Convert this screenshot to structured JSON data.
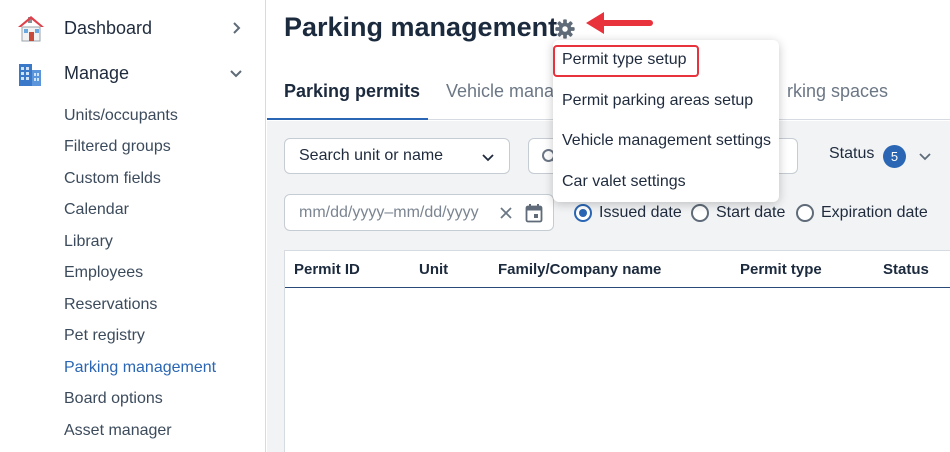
{
  "sidebar": {
    "dashboard_label": "Dashboard",
    "manage_label": "Manage",
    "items": [
      {
        "label": "Units/occupants"
      },
      {
        "label": "Filtered groups"
      },
      {
        "label": "Custom fields"
      },
      {
        "label": "Calendar"
      },
      {
        "label": "Library"
      },
      {
        "label": "Employees"
      },
      {
        "label": "Reservations"
      },
      {
        "label": "Pet registry"
      },
      {
        "label": "Parking management"
      },
      {
        "label": "Board options"
      },
      {
        "label": "Asset manager"
      }
    ]
  },
  "header": {
    "title": "Parking management"
  },
  "tabs": [
    {
      "label": "Parking permits"
    },
    {
      "label": "Vehicle mana"
    },
    {
      "label": "rking spaces"
    }
  ],
  "filters": {
    "search_by_label": "Search unit or name",
    "status_label": "Status",
    "status_count": "5",
    "date_placeholder": "mm/dd/yyyy–mm/dd/yyyy",
    "date_options": [
      {
        "label": "Issued date",
        "checked": true
      },
      {
        "label": "Start date",
        "checked": false
      },
      {
        "label": "Expiration date",
        "checked": false
      }
    ]
  },
  "table": {
    "columns": [
      "Permit ID",
      "Unit",
      "Family/Company name",
      "Permit type",
      "Status"
    ]
  },
  "menu": {
    "items": [
      {
        "label": "Permit type setup"
      },
      {
        "label": "Permit parking areas setup"
      },
      {
        "label": "Vehicle management settings"
      },
      {
        "label": "Car valet settings"
      }
    ]
  },
  "colors": {
    "accent": "#2a66b3",
    "annotation": "#e8323c",
    "content_bg": "#f1f3f5"
  }
}
